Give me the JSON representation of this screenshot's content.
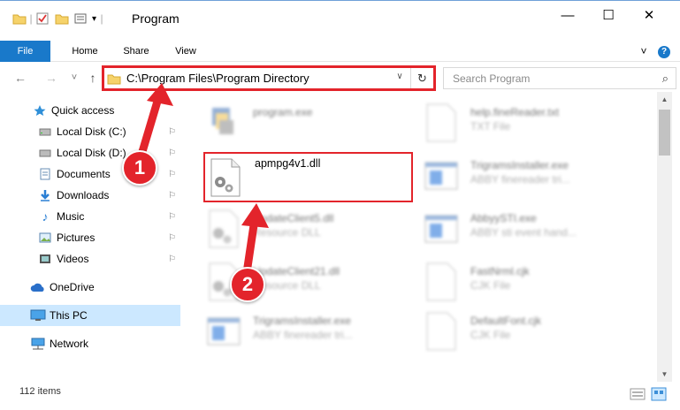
{
  "window": {
    "title": "Program",
    "minimize_glyph": "—",
    "maximize_glyph": "☐",
    "close_glyph": "✕"
  },
  "ribbon": {
    "tabs": [
      {
        "label": "File"
      },
      {
        "label": "Home"
      },
      {
        "label": "Share"
      },
      {
        "label": "View"
      }
    ],
    "expand_glyph": "˅",
    "help_glyph": "?"
  },
  "address": {
    "path": "C:\\Program Files\\Program Directory",
    "dropdown_glyph": "∨",
    "refresh_glyph": "↻"
  },
  "nav": {
    "back_glyph": "←",
    "forward_glyph": "→",
    "recent_glyph": "˅",
    "up_glyph": "↑"
  },
  "search": {
    "placeholder": "Search Program",
    "icon_glyph": "⌕"
  },
  "sidebar": {
    "items": [
      {
        "label": "Quick access",
        "icon": "star-icon"
      },
      {
        "label": "Local Disk (C:)",
        "icon": "drive-icon",
        "pinned": true
      },
      {
        "label": "Local Disk (D:)",
        "icon": "drive-icon",
        "pinned": true
      },
      {
        "label": "Documents",
        "icon": "documents-icon",
        "pinned": true
      },
      {
        "label": "Downloads",
        "icon": "downloads-icon",
        "pinned": true
      },
      {
        "label": "Music",
        "icon": "music-icon",
        "pinned": true
      },
      {
        "label": "Pictures",
        "icon": "pictures-icon",
        "pinned": true
      },
      {
        "label": "Videos",
        "icon": "videos-icon",
        "pinned": true
      },
      {
        "label": "OneDrive",
        "icon": "cloud-icon"
      },
      {
        "label": "This PC",
        "icon": "computer-icon",
        "selected": true
      },
      {
        "label": "Network",
        "icon": "network-icon"
      }
    ],
    "pin_glyph": "⚐"
  },
  "files": [
    {
      "name": "program.exe",
      "desc": ""
    },
    {
      "name": "apmpg4v1.dll",
      "desc": ""
    },
    {
      "name": "UpdateClient5.dll",
      "desc": "Resource DLL"
    },
    {
      "name": "UpdateClient21.dll",
      "desc": "Resource DLL"
    },
    {
      "name": "TrigramsInstaller.exe",
      "desc": "ABBY finereader tri..."
    },
    {
      "name": "help.fineReader.txt",
      "desc": "TXT File"
    },
    {
      "name": "TrigramsInstaller.exe",
      "desc": "ABBY finereader tri..."
    },
    {
      "name": "AbbyySTI.exe",
      "desc": "ABBY sti event hand..."
    },
    {
      "name": "FastNrml.cjk",
      "desc": "CJK File"
    },
    {
      "name": "DefaultFont.cjk",
      "desc": "CJK File"
    }
  ],
  "status": {
    "count": "112 items"
  },
  "annotations": {
    "step1": "1",
    "step2": "2"
  },
  "colors": {
    "accent": "#1979ca",
    "highlight": "#e3242b",
    "selected": "#cce8ff"
  }
}
